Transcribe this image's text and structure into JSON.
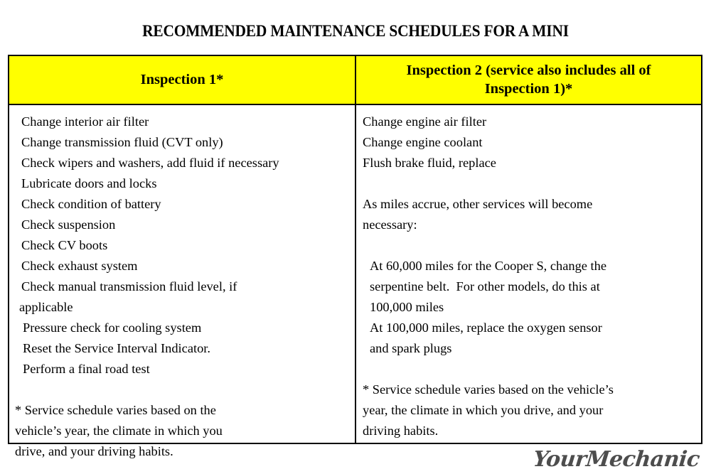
{
  "page": {
    "title": "RECOMMENDED MAINTENANCE SCHEDULES FOR A MINI",
    "brand_logo": "YourMechanic",
    "brand_logo_color": "#4d4d4d",
    "header_background_color": "#ffff00",
    "border_color": "#000000",
    "text_color": "#000000"
  },
  "table": {
    "columns": [
      {
        "id": "inspection-1",
        "header": "Inspection 1*",
        "lines": [
          "Change interior air filter",
          "Change transmission fluid (CVT only)",
          "Check wipers and washers, add fluid if necessary",
          "Lubricate doors and locks",
          "Check condition of battery",
          "Check suspension",
          "Check CV boots",
          "Check exhaust system",
          "Check manual transmission fluid level, if",
          "applicable",
          "Pressure check for cooling system",
          "Reset the Service Interval Indicator.",
          "Perform a final road test"
        ],
        "footnote_lines": [
          "* Service schedule varies based on the",
          "vehicle’s year, the climate in which you",
          "drive, and your driving habits."
        ]
      },
      {
        "id": "inspection-2",
        "header": "Inspection 2 (service also includes all of Inspection 1)*",
        "header_line_1": "Inspection 2 (service also includes all of",
        "header_line_2": "Inspection 1)*",
        "lines": [
          "Change engine air filter",
          "Change engine coolant",
          "Flush brake fluid, replace"
        ],
        "intro_lines": [
          "As miles accrue, other services will become",
          "necessary:"
        ],
        "mileage_lines": [
          "At 60,000 miles for the Cooper S, change the",
          "serpentine belt.  For other models, do this at",
          "100,000 miles",
          "At 100,000 miles, replace the oxygen sensor",
          "and spark plugs"
        ],
        "footnote_lines": [
          "* Service schedule varies based on the vehicle’s",
          "year, the climate in which you drive, and your",
          "driving habits."
        ]
      }
    ]
  }
}
